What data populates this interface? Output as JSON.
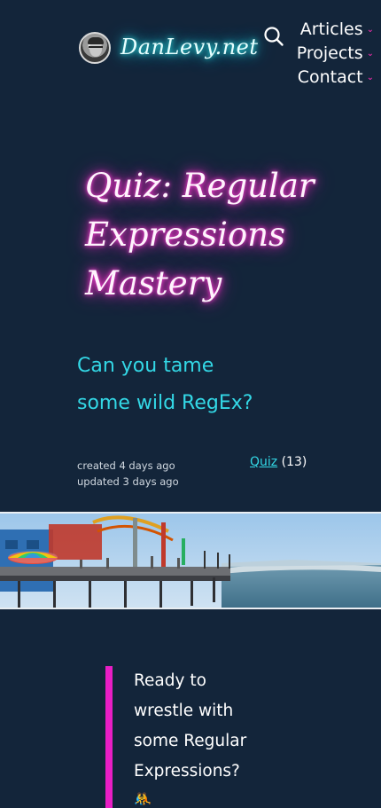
{
  "header": {
    "site_name": "DanLevy.net",
    "nav": [
      {
        "label": "Articles"
      },
      {
        "label": "Projects"
      },
      {
        "label": "Contact"
      }
    ]
  },
  "article": {
    "title_lines": [
      "Quiz: Regular",
      "Expressions",
      "Mastery"
    ],
    "subtitle_lines": [
      "Can you tame",
      "some wild RegEx?"
    ],
    "created": "created 4 days ago",
    "updated": "updated 3 days ago",
    "tag": {
      "label": "Quiz",
      "count": "(13)"
    }
  },
  "callout": {
    "lines": [
      "Ready to",
      "wrestle with",
      "some Regular",
      "Expressions?"
    ],
    "emoji": "🤼"
  },
  "colors": {
    "background": "#13253a",
    "neon_cyan": "#33d8e6",
    "neon_magenta": "#ff2fc8",
    "accent_bar": "#e81ec4"
  }
}
